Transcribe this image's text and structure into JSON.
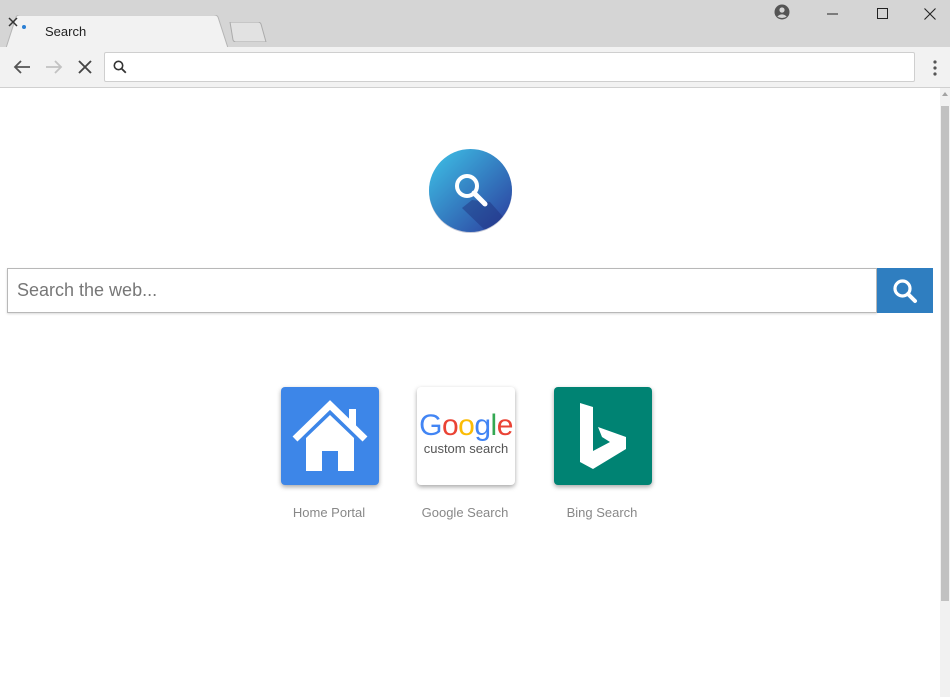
{
  "browser": {
    "tab": {
      "title": "Search"
    },
    "omnibox": {
      "value": "",
      "placeholder": ""
    }
  },
  "page": {
    "search": {
      "placeholder": "Search the web..."
    },
    "shortcuts": [
      {
        "label": "Home Portal",
        "icon": "home-icon",
        "color": "#3d86e8"
      },
      {
        "label": "Google Search",
        "icon": "google-custom-search-icon",
        "logo_text": "Google",
        "logo_subtext": "custom search"
      },
      {
        "label": "Bing Search",
        "icon": "bing-icon",
        "color": "#008373"
      }
    ]
  },
  "colors": {
    "search_button": "#2f7ec0",
    "logo_gradient_start": "#3ec4e8",
    "logo_gradient_end": "#2b3a9c"
  }
}
